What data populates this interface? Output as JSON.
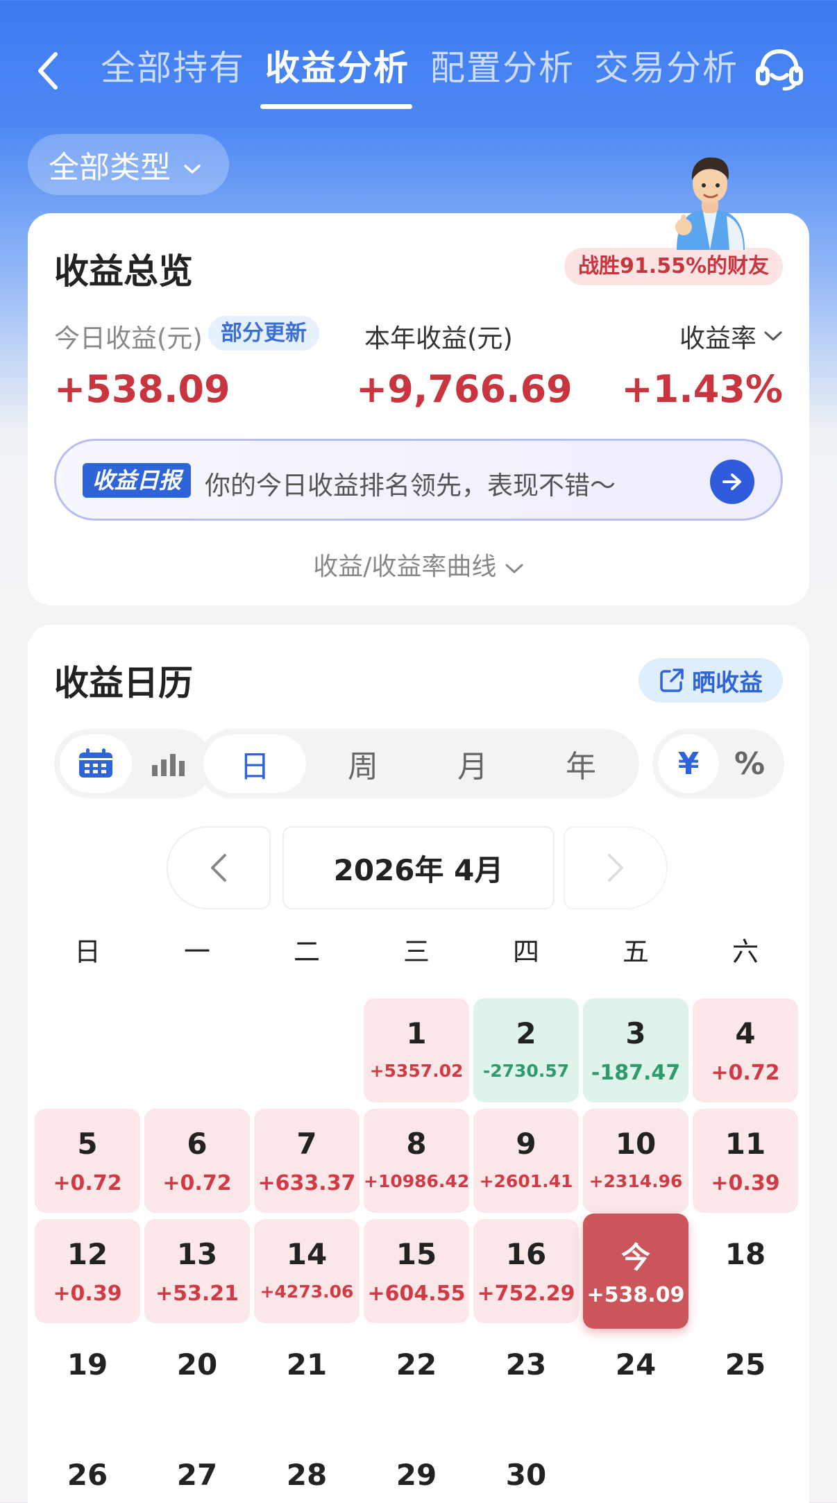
{
  "nav": {
    "tabs": [
      {
        "label": "全部持有",
        "active": false
      },
      {
        "label": "收益分析",
        "active": true
      },
      {
        "label": "配置分析",
        "active": false
      },
      {
        "label": "交易分析",
        "active": false
      }
    ]
  },
  "filter": {
    "label": "全部类型"
  },
  "overview": {
    "title": "收益总览",
    "beat_badge": "战胜91.55%的财友",
    "today_label": "今日收益(元)",
    "update_badge": "部分更新",
    "today_value": "+538.09",
    "year_label": "本年收益(元)",
    "year_value": "+9,766.69",
    "rate_label": "收益率",
    "rate_value": "+1.43%",
    "report_tag": "收益日报",
    "report_msg": "你的今日收益排名领先，表现不错～",
    "curve_toggle": "收益/收益率曲线"
  },
  "calendar": {
    "title": "收益日历",
    "share_label": "晒收益",
    "periods": [
      {
        "label": "日",
        "selected": true
      },
      {
        "label": "周",
        "selected": false
      },
      {
        "label": "月",
        "selected": false
      },
      {
        "label": "年",
        "selected": false
      }
    ],
    "units": [
      {
        "label": "¥",
        "selected": true
      },
      {
        "label": "%",
        "selected": false
      }
    ],
    "view_mode": "calendar",
    "month_label": "2026年 4月",
    "weekdays": [
      "日",
      "一",
      "二",
      "三",
      "四",
      "五",
      "六"
    ],
    "first_weekday_index": 3,
    "days": [
      {
        "day": "1",
        "value": "+5357.02",
        "trend": "up"
      },
      {
        "day": "2",
        "value": "-2730.57",
        "trend": "down"
      },
      {
        "day": "3",
        "value": "-187.47",
        "trend": "down"
      },
      {
        "day": "4",
        "value": "+0.72",
        "trend": "up"
      },
      {
        "day": "5",
        "value": "+0.72",
        "trend": "up"
      },
      {
        "day": "6",
        "value": "+0.72",
        "trend": "up"
      },
      {
        "day": "7",
        "value": "+633.37",
        "trend": "up"
      },
      {
        "day": "8",
        "value": "+10986.42",
        "trend": "up"
      },
      {
        "day": "9",
        "value": "+2601.41",
        "trend": "up"
      },
      {
        "day": "10",
        "value": "+2314.96",
        "trend": "up"
      },
      {
        "day": "11",
        "value": "+0.39",
        "trend": "up"
      },
      {
        "day": "12",
        "value": "+0.39",
        "trend": "up"
      },
      {
        "day": "13",
        "value": "+53.21",
        "trend": "up"
      },
      {
        "day": "14",
        "value": "+4273.06",
        "trend": "up"
      },
      {
        "day": "15",
        "value": "+604.55",
        "trend": "up"
      },
      {
        "day": "16",
        "value": "+752.29",
        "trend": "up"
      },
      {
        "day": "今",
        "value": "+538.09",
        "trend": "today"
      },
      {
        "day": "18",
        "value": "",
        "trend": "none"
      },
      {
        "day": "19",
        "value": "",
        "trend": "none"
      },
      {
        "day": "20",
        "value": "",
        "trend": "none"
      },
      {
        "day": "21",
        "value": "",
        "trend": "none"
      },
      {
        "day": "22",
        "value": "",
        "trend": "none"
      },
      {
        "day": "23",
        "value": "",
        "trend": "none"
      },
      {
        "day": "24",
        "value": "",
        "trend": "none"
      },
      {
        "day": "25",
        "value": "",
        "trend": "none"
      },
      {
        "day": "26",
        "value": "",
        "trend": "none"
      },
      {
        "day": "27",
        "value": "",
        "trend": "none"
      },
      {
        "day": "28",
        "value": "",
        "trend": "none"
      },
      {
        "day": "29",
        "value": "",
        "trend": "none"
      },
      {
        "day": "30",
        "value": "",
        "trend": "none"
      }
    ]
  }
}
